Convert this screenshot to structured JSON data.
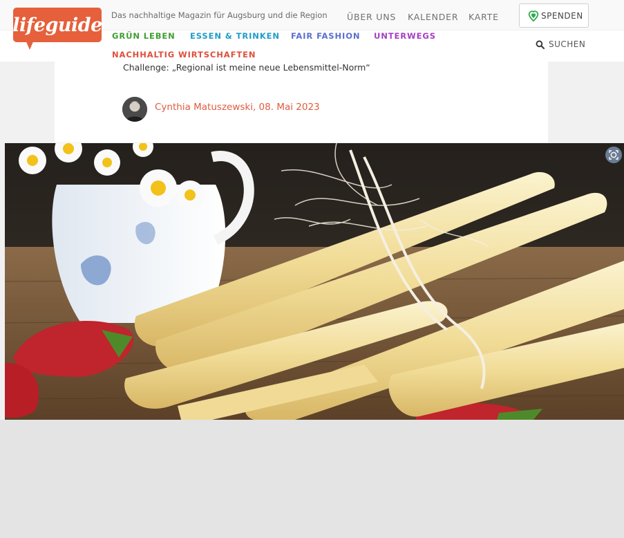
{
  "header": {
    "logo_text": "lifeguide",
    "tagline": "Das nachhaltige Magazin für Augsburg und die Region",
    "top_nav": [
      "ÜBER UNS",
      "KALENDER",
      "KARTE"
    ],
    "donate_label": "SPENDEN",
    "categories": {
      "gruen": "GRÜN LEBEN",
      "essen": "ESSEN & TRINKEN",
      "fair": "FAIR FASHION",
      "unterwegs": "UNTERWEGS",
      "nachhaltig": "NACHHALTIG WIRTSCHAFTEN"
    },
    "search_label": "SUCHEN"
  },
  "article": {
    "subtitle": "Challenge: „Regional ist meine neue Lebensmittel-Norm“",
    "author_line": "Cynthia Matuszewski, 08. Mai 2023"
  },
  "icons": {
    "donate": "heart-pin-icon",
    "search": "search-icon",
    "lens": "lens-icon"
  },
  "colors": {
    "brand": "#e5603b",
    "gruen": "#3f9e32",
    "essen": "#1e9cc9",
    "fair": "#5a6fcc",
    "unterwegs": "#a43fc2",
    "nachhaltig": "#df4f3c",
    "donate_icon": "#2fa84f"
  }
}
